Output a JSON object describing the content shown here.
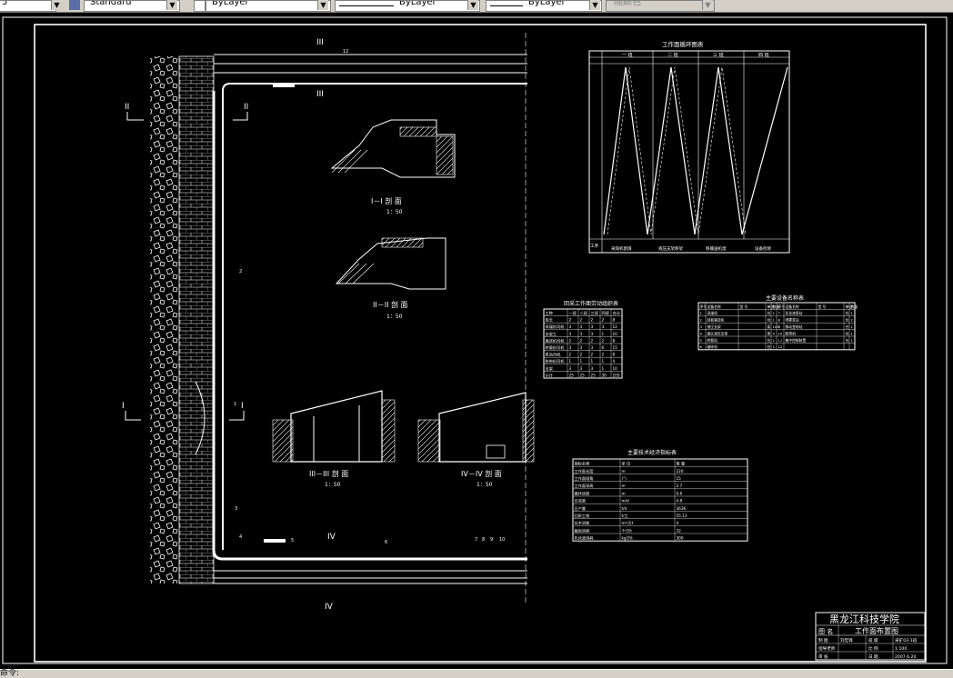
{
  "toolbar": {
    "left_fragment": "5",
    "text_style": "Standard",
    "layer": "ByLayer",
    "linetype": "ByLayer",
    "lineweight": "ByLayer",
    "color": "随颜色"
  },
  "status": {
    "command": "命令:"
  },
  "drawing": {
    "sections": {
      "s1_title": "I－I 剖 面",
      "s1_scale": "1：50",
      "s2_title": "II－II 剖 面",
      "s2_scale": "1：50",
      "s3_title": "III－III 剖 面",
      "s3_scale": "1：50",
      "s4_title": "IV－IV 剖 面",
      "s4_scale": "1：50"
    },
    "markers": {
      "I": "I",
      "II": "II",
      "III": "III",
      "IV": "IV"
    },
    "cycle_chart": {
      "title": "工作面循环图表",
      "shifts": [
        "一 班",
        "二 班",
        "三 班",
        "四 班"
      ],
      "footer": [
        "采煤机割煤",
        "液压支架移架",
        "移输送机溜",
        "设备检修"
      ],
      "left_label": "工序"
    },
    "labor_table": {
      "title": "回采工作面劳动组织表",
      "headers": [
        "工种",
        "一班",
        "二班",
        "三班",
        "四班",
        "合计"
      ],
      "rows": [
        [
          "班长",
          "2",
          "2",
          "2",
          "2",
          "8"
        ],
        [
          "采煤机司机",
          "3",
          "3",
          "3",
          "3",
          "12"
        ],
        [
          "支架工",
          "3",
          "3",
          "3",
          "1",
          "10"
        ],
        [
          "输送机司机",
          "2",
          "2",
          "2",
          "2",
          "8"
        ],
        [
          "转载机司机",
          "3",
          "3",
          "3",
          "6",
          "15"
        ],
        [
          "泵站司机",
          "2",
          "2",
          "2",
          "2",
          "8"
        ],
        [
          "胶带机司机",
          "1",
          "1",
          "1",
          "1",
          "4"
        ],
        [
          "支架",
          "3",
          "3",
          "3",
          "1",
          "10"
        ],
        [
          "小计",
          "25",
          "25",
          "25",
          "30",
          "105"
        ]
      ]
    },
    "equipment_table": {
      "title": "主要设备名称表",
      "headers": [
        "序号",
        "设备名称",
        "型 号",
        "单位",
        "数量",
        "序号",
        "设备名称",
        "型 号",
        "单位",
        "数量"
      ],
      "rows": [
        [
          "1",
          "采煤机",
          "",
          "台",
          "1",
          "7",
          "乳化液泵站",
          "",
          "台",
          "1"
        ],
        [
          "2",
          "刮板输送机",
          "",
          "台",
          "1",
          "8",
          "喷雾泵站",
          "",
          "台",
          "2"
        ],
        [
          "3",
          "液压支架",
          "",
          "架",
          "105",
          "9",
          "移动变电站",
          "",
          "台",
          "1"
        ],
        [
          "4",
          "端头液压支架",
          "",
          "架",
          "4",
          "10",
          "胶带机",
          "",
          "台",
          "1"
        ],
        [
          "5",
          "转载机",
          "",
          "台",
          "1",
          "11",
          "集中控制装置",
          "",
          "台",
          "1"
        ],
        [
          "6",
          "破碎机",
          "",
          "台",
          "1",
          "12",
          "",
          "",
          "",
          ""
        ]
      ]
    },
    "tech_table": {
      "title": "主要技术经济指标表",
      "headers": [
        "指标名称",
        "单 位",
        "数 量"
      ],
      "rows": [
        [
          "工作面长度",
          "m",
          "220"
        ],
        [
          "工作面倾角",
          "(°)",
          "15"
        ],
        [
          "工作面采高",
          "m",
          "2.7"
        ],
        [
          "循环进度",
          "m",
          "0.6"
        ],
        [
          "日进度",
          "m/d",
          "4.8"
        ],
        [
          "日产量",
          "t/d",
          "3636"
        ],
        [
          "回采工效",
          "t/工",
          "55.13"
        ],
        [
          "坑木消耗",
          "m³/万t",
          "4"
        ],
        [
          "截齿消耗",
          "个/万t",
          "32"
        ],
        [
          "乳化液消耗",
          "kg/万t",
          "300"
        ]
      ]
    },
    "title_block": {
      "school": "黑龙江科技学院",
      "name_label": "图 名",
      "name": "工作面布置图",
      "rows": [
        [
          "制 图",
          "刘忠锋",
          "班 级",
          "采矿03-1班"
        ],
        [
          "指导老师",
          "",
          "比 例",
          "1:100"
        ],
        [
          "审 核",
          "",
          "日 期",
          "2007.6.20"
        ]
      ]
    },
    "numbers": [
      "1",
      "2",
      "3",
      "4",
      "5",
      "6",
      "7",
      "8",
      "9",
      "10",
      "11",
      "12"
    ]
  }
}
